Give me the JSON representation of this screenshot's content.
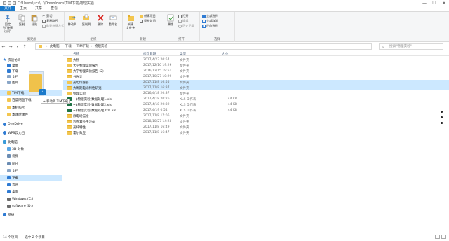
{
  "window": {
    "title": "C:\\Users\\ucz\\...\\Downloads\\TIM下载\\物理实验",
    "min_label": "—",
    "max_label": "☐",
    "close_label": "✕"
  },
  "ribbon_tabs": [
    "文件",
    "主页",
    "共享",
    "查看"
  ],
  "ribbon": {
    "clipboard": {
      "label": "剪贴板",
      "pin": "固定到\"快速访问\"",
      "copy": "复制",
      "paste": "粘贴",
      "cut": "剪切",
      "copy_path": "复制路径",
      "paste_shortcut": "粘贴快捷方式"
    },
    "organize": {
      "label": "组织",
      "move_to": "移动到",
      "copy_to": "复制到",
      "delete": "删除",
      "rename": "重命名"
    },
    "new": {
      "label": "新建",
      "new_folder": "新建\n文件夹",
      "new_item": "新建项目",
      "easy_access": "轻松访问"
    },
    "open": {
      "label": "打开",
      "properties": "属性",
      "open": "打开",
      "edit": "编辑",
      "history": "历史记录"
    },
    "select": {
      "label": "选择",
      "select_all": "全部选择",
      "select_none": "全部取消",
      "invert": "反向选择"
    }
  },
  "address": {
    "parts": [
      "此电脑",
      "下载",
      "TIM下载",
      "物理实验"
    ],
    "search_placeholder": "搜索\"物理实验\""
  },
  "nav_pane": {
    "items": [
      {
        "label": "快速访问",
        "icon": "star-icon",
        "color": "#2f7bd3"
      },
      {
        "label": "桌面",
        "icon": "desktop-icon",
        "color": "#2f7bd3"
      },
      {
        "label": "下载",
        "icon": "download-icon",
        "color": "#2f7bd3"
      },
      {
        "label": "文档",
        "icon": "document-icon",
        "color": "#8aa6c7"
      },
      {
        "label": "图片",
        "icon": "picture-icon",
        "color": "#8aa6c7"
      },
      {
        "label": "TIM下载",
        "icon": "folder-icon",
        "color": "#f3c64f"
      },
      {
        "label": "百度网盘下载",
        "icon": "folder-icon",
        "color": "#f3c64f"
      },
      {
        "label": "本机照片",
        "icon": "folder-icon",
        "color": "#f3c64f"
      },
      {
        "label": "本课时课件",
        "icon": "folder-icon",
        "color": "#f3c64f"
      },
      {
        "label": "OneDrive",
        "icon": "cloud-icon",
        "color": "#2f7bd3"
      },
      {
        "label": "WPS云文档",
        "icon": "cloud-icon",
        "color": "#2f7bd3"
      },
      {
        "label": "此电脑",
        "icon": "computer-icon",
        "color": "#3a9bd9"
      },
      {
        "label": "3D 对象",
        "icon": "cube-icon",
        "color": "#5aa6e6"
      },
      {
        "label": "视频",
        "icon": "video-icon",
        "color": "#6b8cb3"
      },
      {
        "label": "图片",
        "icon": "picture-icon",
        "color": "#6b8cb3"
      },
      {
        "label": "文档",
        "icon": "document-icon",
        "color": "#8aa6c7"
      },
      {
        "label": "下载",
        "icon": "download-icon",
        "color": "#2f7bd3"
      },
      {
        "label": "音乐",
        "icon": "music-icon",
        "color": "#2f7bd3"
      },
      {
        "label": "桌面",
        "icon": "desktop-icon",
        "color": "#2f7bd3"
      },
      {
        "label": "Windows (C:)",
        "icon": "drive-icon",
        "color": "#6b6b6b"
      },
      {
        "label": "software (D:)",
        "icon": "drive-icon",
        "color": "#6b6b6b"
      },
      {
        "label": "网络",
        "icon": "network-icon",
        "color": "#2f7bd3"
      }
    ]
  },
  "columns": {
    "name": "名称",
    "date": "修改日期",
    "type": "类型",
    "size": "大小"
  },
  "files": [
    {
      "name": "大物",
      "date": "2017/4/23 20:54",
      "type": "文件夹",
      "size": "",
      "kind": "folder",
      "selected": false
    },
    {
      "name": "大学物理实验报告",
      "date": "2017/12/10 19:29",
      "type": "文件夹",
      "size": "",
      "kind": "folder",
      "selected": false
    },
    {
      "name": "大学物理实验报告 (2)",
      "date": "2016/12/15 19:51",
      "type": "文件夹",
      "size": "",
      "kind": "folder",
      "selected": false
    },
    {
      "name": "分光计",
      "date": "2017/10/27 10:29",
      "type": "文件夹",
      "size": "",
      "kind": "folder",
      "selected": false
    },
    {
      "name": "光电传感器",
      "date": "2017/11/8 16:55",
      "type": "文件夹",
      "size": "",
      "kind": "folder",
      "selected": true
    },
    {
      "name": "大周期电光特性研究",
      "date": "2017/11/8 16:37",
      "type": "文件夹",
      "size": "",
      "kind": "folder",
      "selected": true
    },
    {
      "name": "物理实验",
      "date": "2016/4/18 20:37",
      "type": "文件夹",
      "size": "",
      "kind": "folder",
      "selected": false
    },
    {
      "name": "~$物理实验-数据处理1.xls",
      "date": "2017/4/18 20:26",
      "type": "XLS 工作表",
      "size": "44 KB",
      "kind": "xls",
      "selected": false
    },
    {
      "name": "~$物理实验-数据处理2.xls",
      "date": "2017/4/18 20:39",
      "type": "XLS 工作表",
      "size": "44 KB",
      "kind": "xls",
      "selected": false
    },
    {
      "name": "~$物理实验-数据处理3xls.xls",
      "date": "2017/4/19 0:54",
      "type": "XLS 工作表",
      "size": "44 KB",
      "kind": "xls",
      "selected": false
    },
    {
      "name": "静电场描绘",
      "date": "2017/11/8 17:06",
      "type": "文件夹",
      "size": "",
      "kind": "folder",
      "selected": false
    },
    {
      "name": "迈克耳孙干涉仪",
      "date": "2018/10/27 14:23",
      "type": "文件夹",
      "size": "",
      "kind": "folder",
      "selected": false
    },
    {
      "name": "光纤特性",
      "date": "2017/11/8 16:49",
      "type": "文件夹",
      "size": "",
      "kind": "folder",
      "selected": false
    },
    {
      "name": "霍尔效应",
      "date": "2017/11/8 16:47",
      "type": "文件夹",
      "size": "",
      "kind": "folder",
      "selected": false
    }
  ],
  "drag": {
    "count": "2",
    "tooltip": "→ 移动到 TIM下载"
  },
  "status": {
    "items": "14 个项目",
    "selected": "选中 2 个项目"
  }
}
